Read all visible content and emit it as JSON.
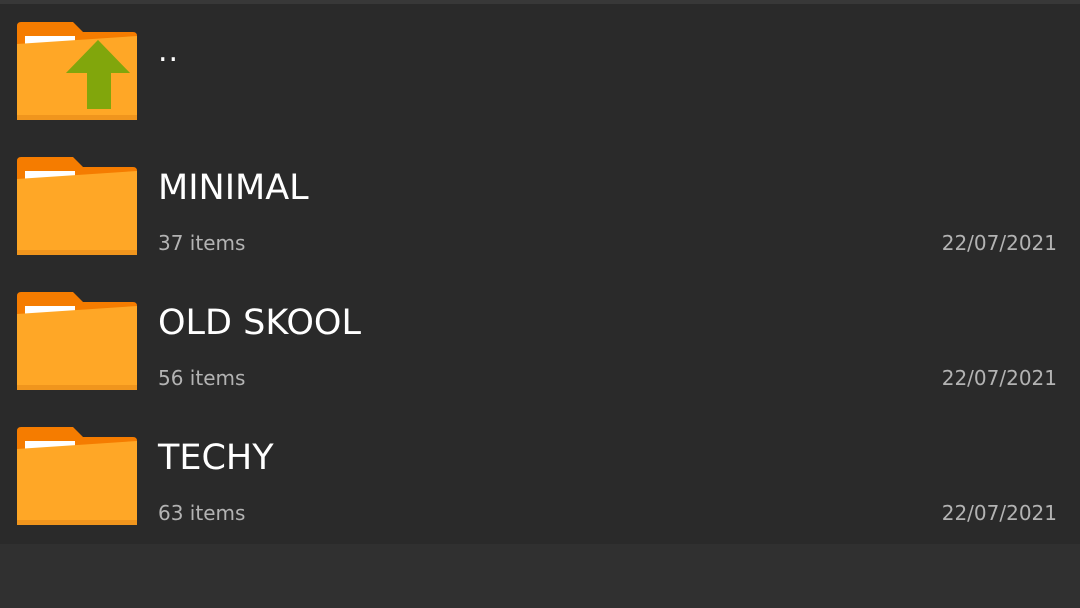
{
  "parent_entry": {
    "name": "..",
    "icon": "folder-up-icon"
  },
  "folders": [
    {
      "name": "MINIMAL",
      "items": "37 items",
      "date": "22/07/2021",
      "icon": "folder-icon"
    },
    {
      "name": "OLD SKOOL",
      "items": "56 items",
      "date": "22/07/2021",
      "icon": "folder-icon"
    },
    {
      "name": "TECHY",
      "items": "63 items",
      "date": "22/07/2021",
      "icon": "folder-icon"
    }
  ],
  "colors": {
    "background": "#2a2a2a",
    "folder_body": "#ffa726",
    "folder_tab": "#f57c00",
    "up_arrow": "#7cb342",
    "primary_text": "#ffffff",
    "secondary_text": "#b3b3b3"
  }
}
